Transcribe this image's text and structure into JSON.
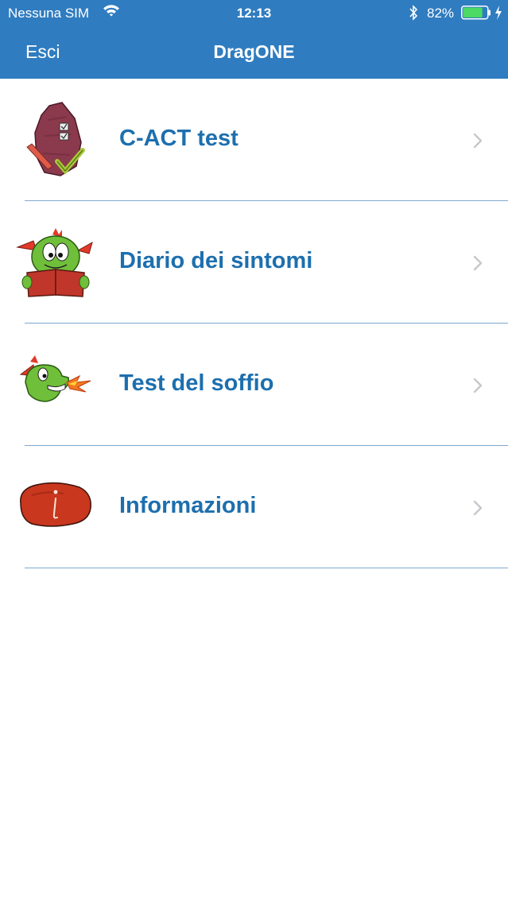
{
  "status_bar": {
    "carrier": "Nessuna SIM",
    "time": "12:13",
    "battery": "82%",
    "battery_level": 0.82,
    "battery_color": "#4cd964"
  },
  "nav": {
    "back_label": "Esci",
    "title": "DragONE",
    "bar_color": "#2f7cc0"
  },
  "menu": [
    {
      "label": "C-ACT test",
      "icon": "checklist-stone-icon"
    },
    {
      "label": "Diario dei sintomi",
      "icon": "dragon-reading-icon"
    },
    {
      "label": "Test del soffio",
      "icon": "fire-breathing-dragon-icon"
    },
    {
      "label": "Informazioni",
      "icon": "info-stone-icon"
    }
  ],
  "colors": {
    "accent_text": "#1d6fae",
    "separator": "#7fa9cc"
  }
}
